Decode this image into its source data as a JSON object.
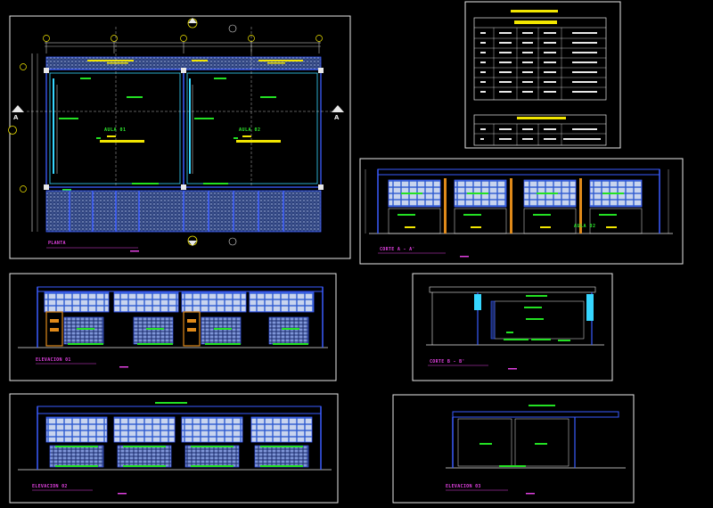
{
  "colors": {
    "background": "#000000",
    "frame": "#e8e8e8",
    "wall": "#3a5cff",
    "cyan": "#36d6ff",
    "green": "#23e123",
    "yellow": "#f2e600",
    "magenta": "#e040e0",
    "orange": "#e08a1a",
    "hatch": "#8aa0d8"
  },
  "icons": {
    "section_marker": "section-arrow-icon",
    "axis_bubble": "axis-bubble-icon",
    "north": "north-arrow-icon"
  },
  "plan": {
    "title": "PLANTA",
    "rooms": [
      "AULA 01",
      "AULA 02"
    ],
    "section_marks": [
      "A",
      "A"
    ]
  },
  "sheets": {
    "section_aa": "CORTE A - A'",
    "section_bb": "CORTE B - B'",
    "elevation_1": "ELEVACION 01",
    "elevation_2": "ELEVACION 02",
    "elevation_3": "ELEVACION 03",
    "section_room": "AULA 02"
  }
}
